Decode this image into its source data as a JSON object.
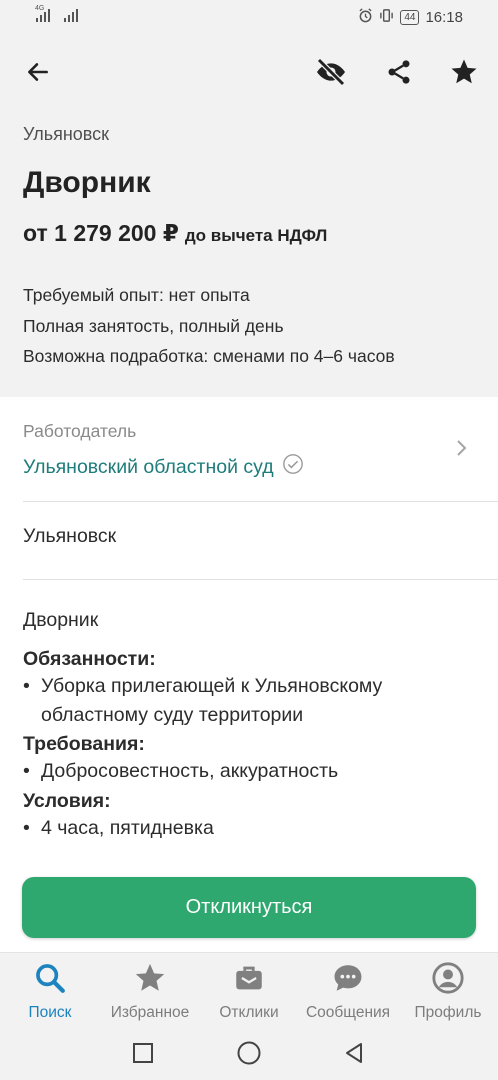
{
  "status_bar": {
    "network_label": "4G",
    "battery": "44",
    "time": "16:18",
    "icons": [
      "signal-icon",
      "alarm-icon",
      "vibrate-icon",
      "battery-icon"
    ]
  },
  "app_bar": {
    "icons": [
      "back-arrow-icon",
      "hide-eye-icon",
      "share-icon",
      "star-icon"
    ]
  },
  "vacancy": {
    "city": "Ульяновск",
    "title": "Дворник",
    "salary": "от 1 279 200 ₽",
    "salary_note": "до вычета НДФЛ",
    "facts": [
      "Требуемый опыт: нет опыта",
      "Полная занятость, полный день",
      "Возможна подработка: сменами по 4–6 часов"
    ]
  },
  "employer": {
    "caption": "Работодатель",
    "name": "Ульяновский областной суд",
    "verified_icon": "verified-check-icon",
    "chevron_icon": "chevron-right-icon"
  },
  "location": "Ульяновск",
  "description": {
    "job_title": "Дворник",
    "sections": [
      {
        "heading": "Обязанности:",
        "items": [
          "Уборка прилегающей к Ульяновскому областному суду территории"
        ]
      },
      {
        "heading": "Требования:",
        "items": [
          "Добросовестность, аккуратность"
        ]
      },
      {
        "heading": "Условия:",
        "items": [
          "4 часа, пятидневка"
        ]
      }
    ]
  },
  "cta": {
    "label": "Откликнуться"
  },
  "bottom_nav": {
    "active": "Поиск",
    "accent": "#1d83bf",
    "items": [
      {
        "label": "Поиск",
        "icon": "search-icon"
      },
      {
        "label": "Избранное",
        "icon": "star-icon"
      },
      {
        "label": "Отклики",
        "icon": "briefcase-icon"
      },
      {
        "label": "Сообщения",
        "icon": "chat-icon"
      },
      {
        "label": "Профиль",
        "icon": "profile-icon"
      }
    ]
  },
  "colors": {
    "brand_green": "#2ea86f",
    "link_teal": "#1e7c7a",
    "active_blue": "#1d83bf"
  }
}
